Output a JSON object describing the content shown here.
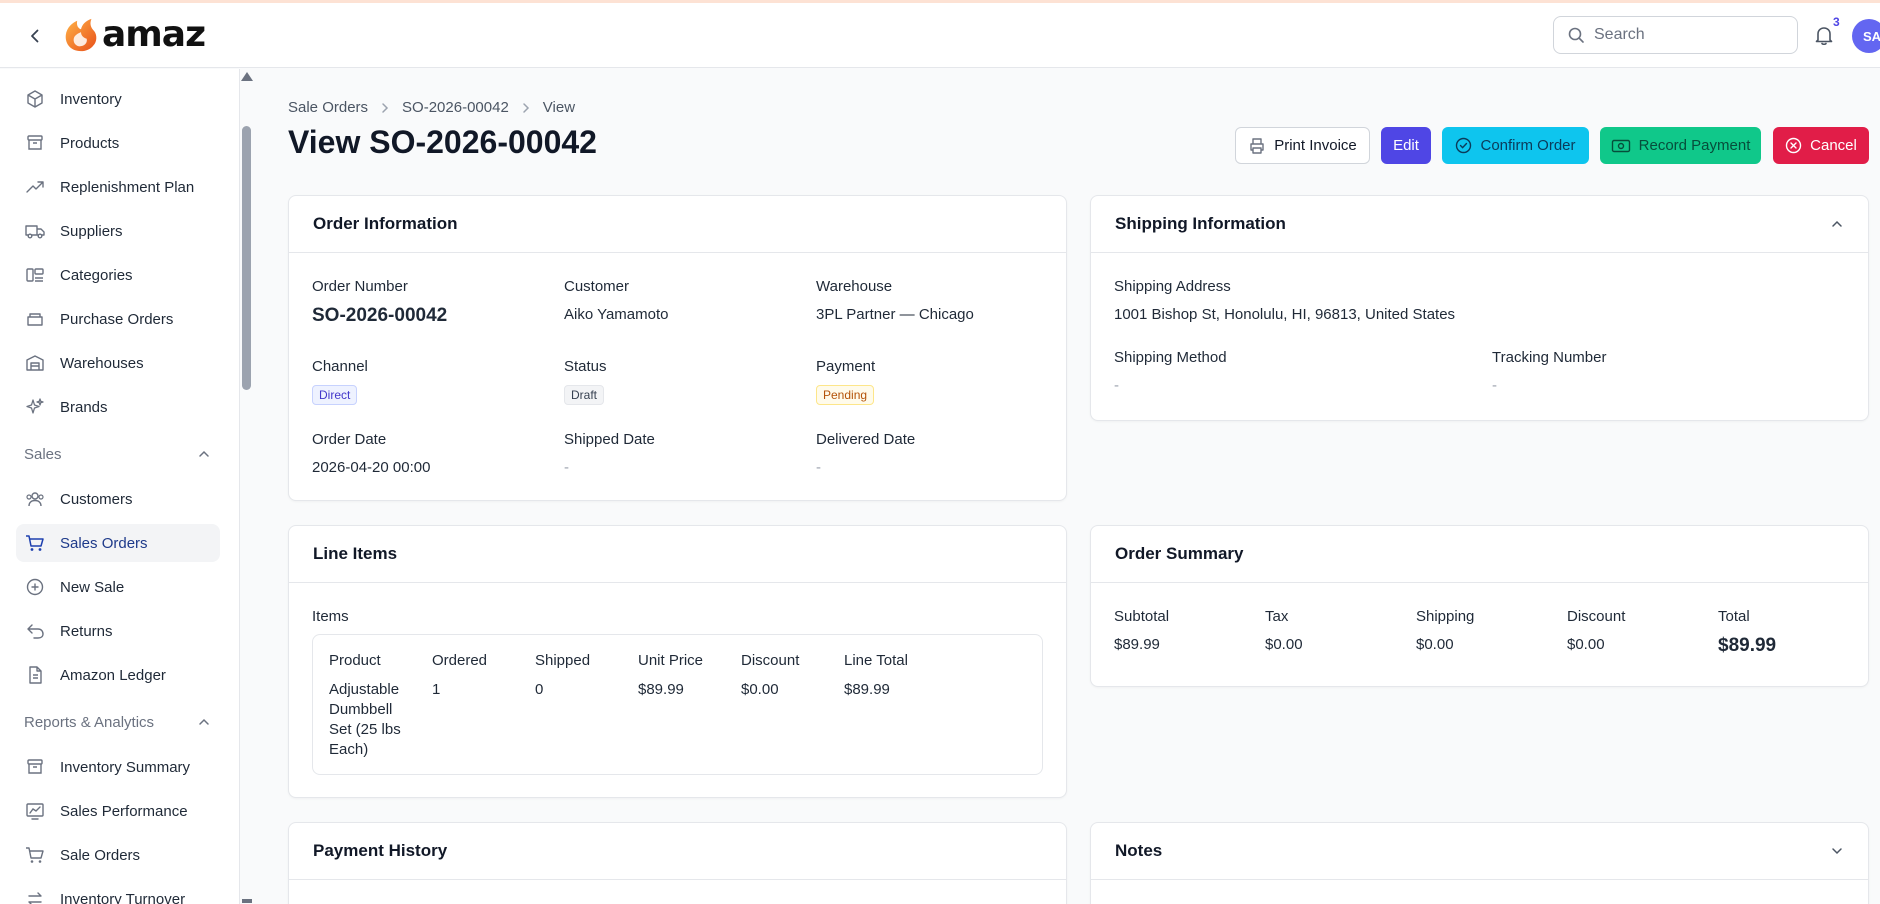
{
  "app": {
    "logo_text": "amaz"
  },
  "header": {
    "search_placeholder": "Search",
    "notification_count": "3",
    "avatar_initials": "SA"
  },
  "sidebar": {
    "items": [
      {
        "label": "Inventory",
        "icon": "box-icon"
      },
      {
        "label": "Products",
        "icon": "archive-icon"
      },
      {
        "label": "Replenishment Plan",
        "icon": "trending-up-icon"
      },
      {
        "label": "Suppliers",
        "icon": "truck-icon"
      },
      {
        "label": "Categories",
        "icon": "categories-icon"
      },
      {
        "label": "Purchase Orders",
        "icon": "purchase-icon"
      },
      {
        "label": "Warehouses",
        "icon": "warehouse-icon"
      },
      {
        "label": "Brands",
        "icon": "sparkles-icon"
      }
    ],
    "sales_group": "Sales",
    "sales_items": [
      {
        "label": "Customers",
        "icon": "users-icon"
      },
      {
        "label": "Sales Orders",
        "icon": "cart-icon"
      },
      {
        "label": "New Sale",
        "icon": "plus-circle-icon"
      },
      {
        "label": "Returns",
        "icon": "return-icon"
      },
      {
        "label": "Amazon Ledger",
        "icon": "document-icon"
      }
    ],
    "reports_group": "Reports & Analytics",
    "reports_items": [
      {
        "label": "Inventory Summary",
        "icon": "archive-icon"
      },
      {
        "label": "Sales Performance",
        "icon": "chart-icon"
      },
      {
        "label": "Sale Orders",
        "icon": "cart-icon"
      },
      {
        "label": "Inventory Turnover",
        "icon": "turnover-icon"
      }
    ]
  },
  "breadcrumb": {
    "root": "Sale Orders",
    "order": "SO-2026-00042",
    "current": "View"
  },
  "page": {
    "title": "View SO-2026-00042"
  },
  "actions": {
    "print": "Print Invoice",
    "edit": "Edit",
    "confirm": "Confirm Order",
    "payment": "Record Payment",
    "cancel": "Cancel"
  },
  "order_info": {
    "title": "Order Information",
    "order_number_label": "Order Number",
    "order_number": "SO-2026-00042",
    "customer_label": "Customer",
    "customer": "Aiko Yamamoto",
    "warehouse_label": "Warehouse",
    "warehouse": "3PL Partner — Chicago",
    "channel_label": "Channel",
    "channel": "Direct",
    "status_label": "Status",
    "status": "Draft",
    "payment_label": "Payment",
    "payment": "Pending",
    "order_date_label": "Order Date",
    "order_date": "2026-04-20 00:00",
    "shipped_date_label": "Shipped Date",
    "shipped_date": "-",
    "delivered_date_label": "Delivered Date",
    "delivered_date": "-"
  },
  "shipping_info": {
    "title": "Shipping Information",
    "address_label": "Shipping Address",
    "address": "1001 Bishop St, Honolulu, HI, 96813, United States",
    "method_label": "Shipping Method",
    "method": "-",
    "tracking_label": "Tracking Number",
    "tracking": "-"
  },
  "line_items": {
    "title": "Line Items",
    "items_label": "Items",
    "columns": [
      "Product",
      "Ordered",
      "Shipped",
      "Unit Price",
      "Discount",
      "Line Total"
    ],
    "rows": [
      [
        "Adjustable Dumbbell Set (25 lbs Each)",
        "1",
        "0",
        "$89.99",
        "$0.00",
        "$89.99"
      ]
    ]
  },
  "order_summary": {
    "title": "Order Summary",
    "subtotal_label": "Subtotal",
    "subtotal": "$89.99",
    "tax_label": "Tax",
    "tax": "$0.00",
    "shipping_label": "Shipping",
    "shipping": "$0.00",
    "discount_label": "Discount",
    "discount": "$0.00",
    "total_label": "Total",
    "total": "$89.99"
  },
  "payment_history": {
    "title": "Payment History"
  },
  "notes": {
    "title": "Notes"
  }
}
